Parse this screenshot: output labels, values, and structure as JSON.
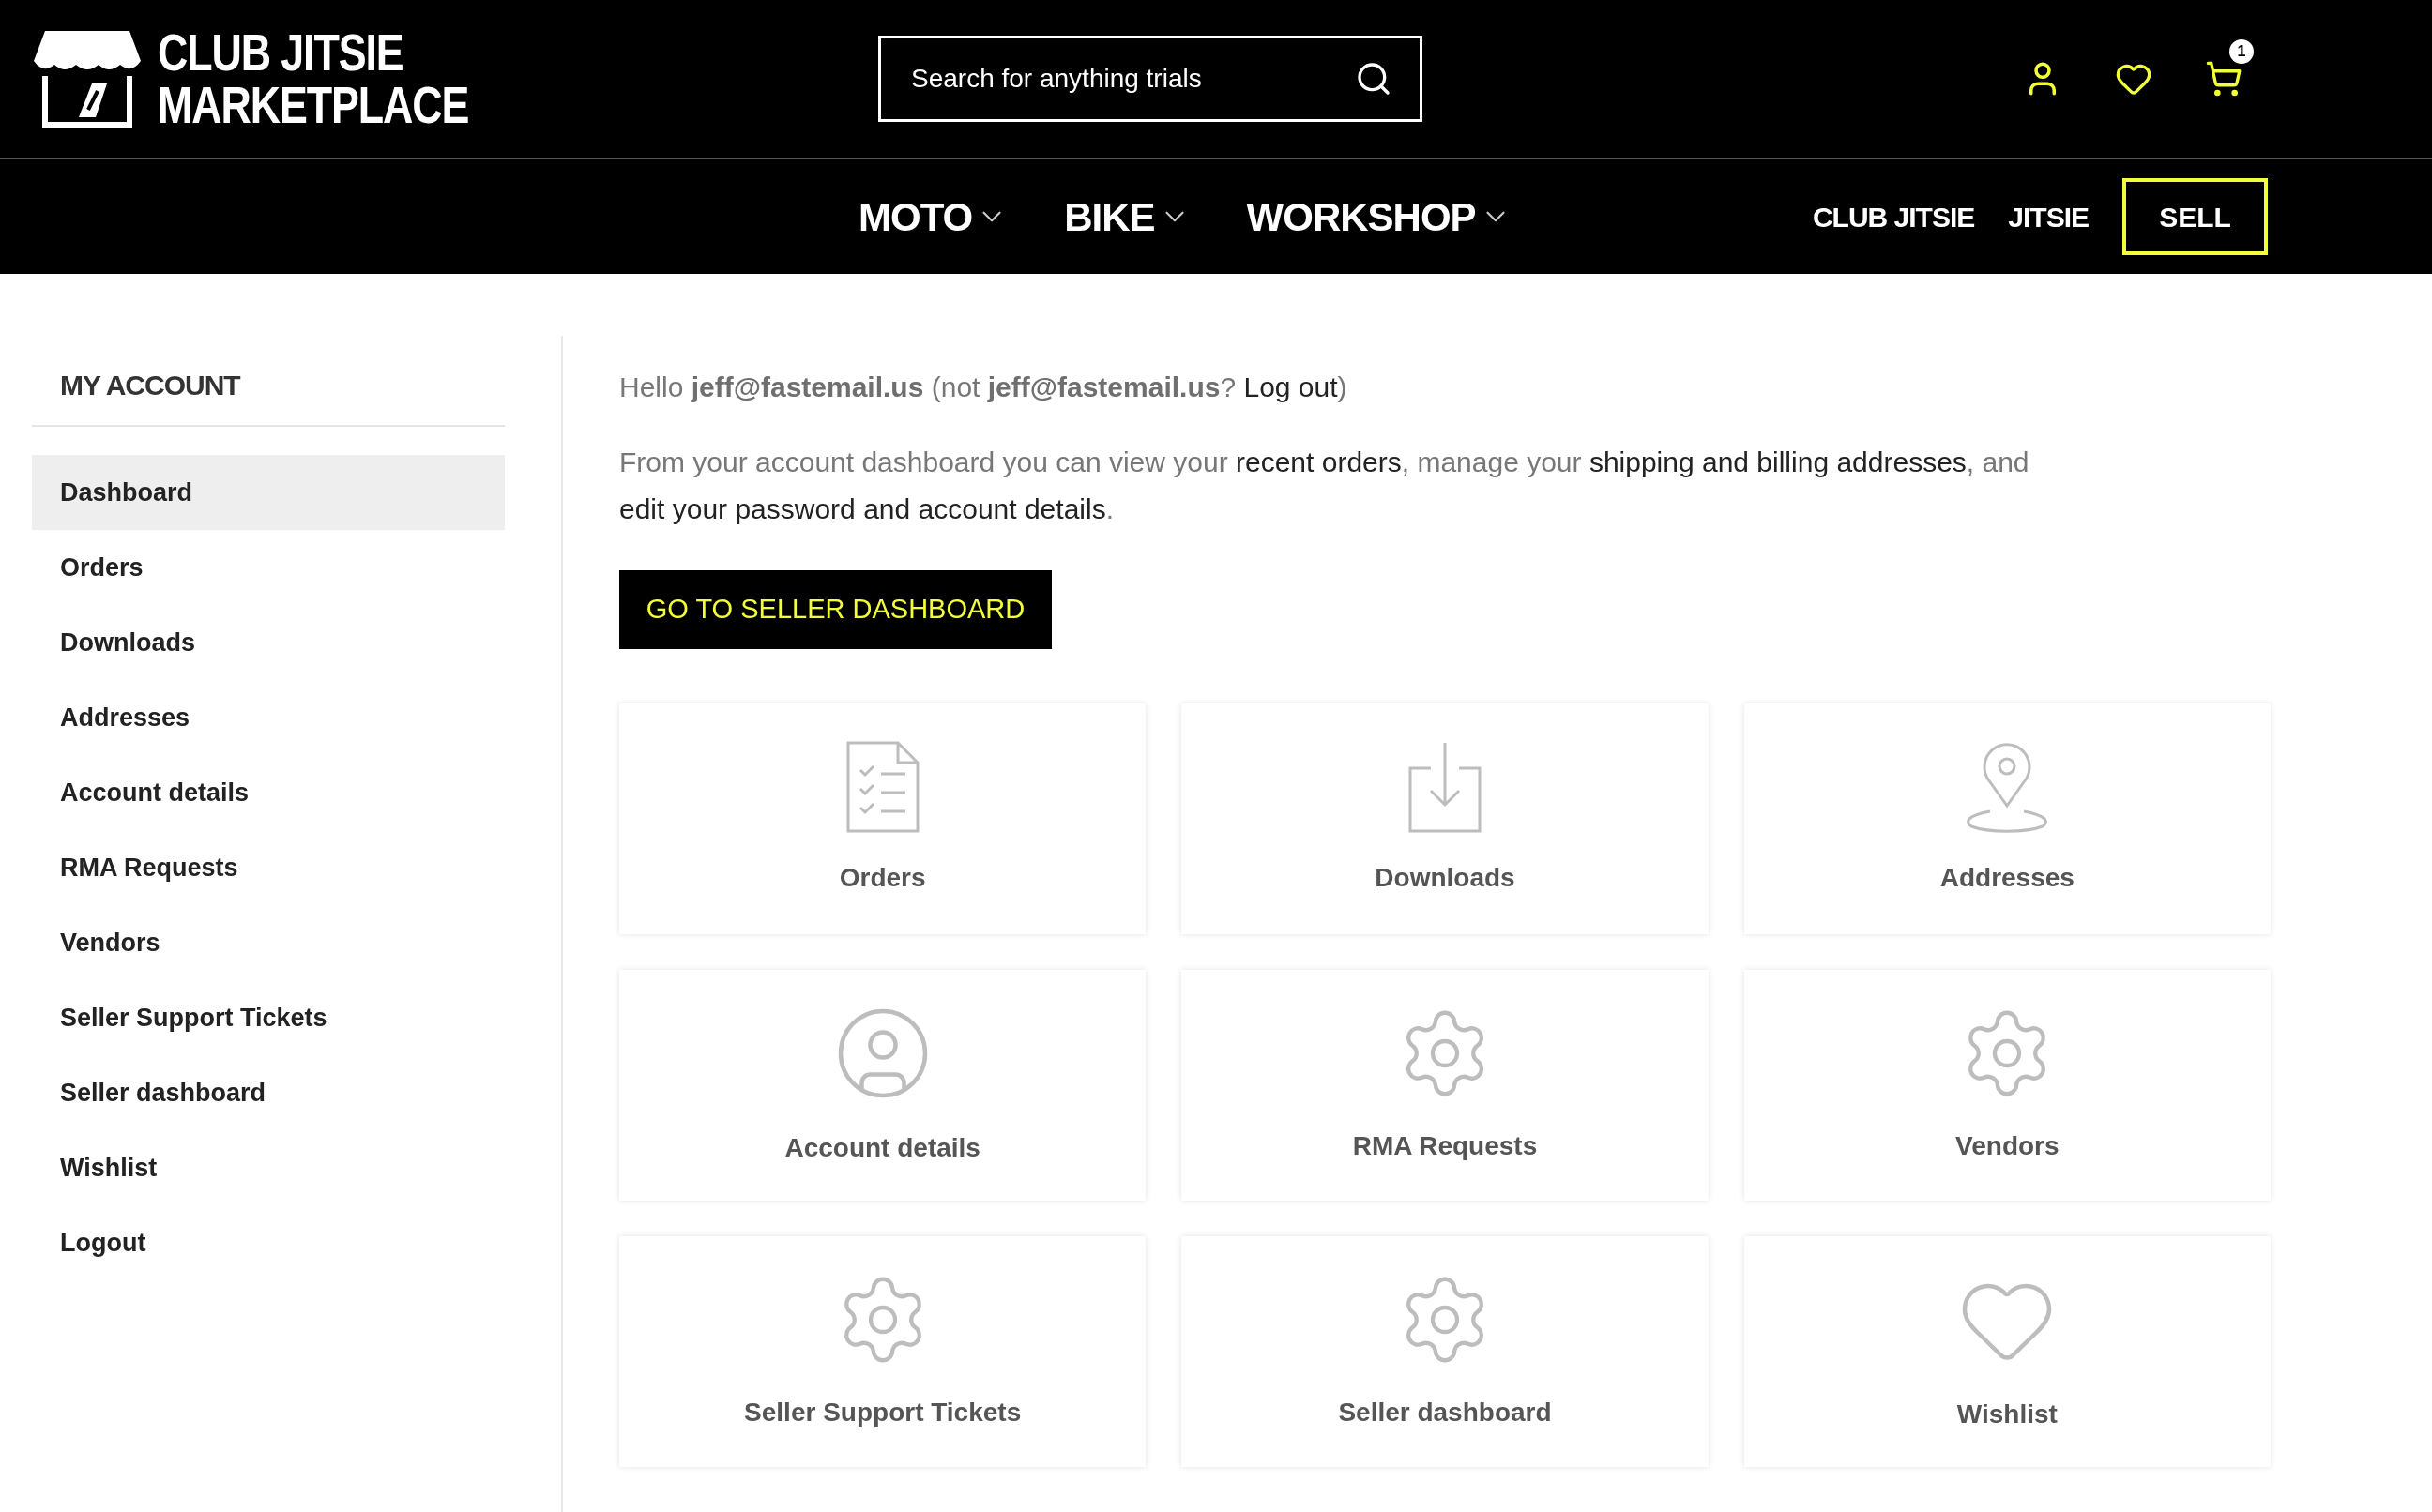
{
  "header": {
    "logo": {
      "line_1": "CLUB JITSIE",
      "line_2": "MARKETPLACE"
    },
    "search": {
      "placeholder": "Search for anything trials"
    },
    "cart_count": "1"
  },
  "nav": {
    "menus": [
      {
        "label": "MOTO"
      },
      {
        "label": "BIKE"
      },
      {
        "label": "WORKSHOP"
      }
    ],
    "links": [
      "CLUB JITSIE",
      "JITSIE"
    ],
    "sell_button": "SELL"
  },
  "sidebar": {
    "title": "MY ACCOUNT",
    "items": [
      {
        "label": "Dashboard",
        "selected": true
      },
      {
        "label": "Orders",
        "selected": false
      },
      {
        "label": "Downloads",
        "selected": false
      },
      {
        "label": "Addresses",
        "selected": false
      },
      {
        "label": "Account details",
        "selected": false
      },
      {
        "label": "RMA Requests",
        "selected": false
      },
      {
        "label": "Vendors",
        "selected": false
      },
      {
        "label": "Seller Support Tickets",
        "selected": false
      },
      {
        "label": "Seller dashboard",
        "selected": false
      },
      {
        "label": "Wishlist",
        "selected": false
      },
      {
        "label": "Logout",
        "selected": false
      }
    ]
  },
  "greeting": [
    {
      "kind": "plain",
      "text": "Hello "
    },
    {
      "kind": "strong",
      "text": "jeff@fastemail.us"
    },
    {
      "kind": "plain",
      "text": " (not "
    },
    {
      "kind": "strong",
      "text": "jeff@fastemail.us"
    },
    {
      "kind": "plain",
      "text": "? "
    },
    {
      "kind": "link",
      "text": "Log out"
    },
    {
      "kind": "plain",
      "text": ")"
    }
  ],
  "intro": [
    {
      "kind": "plain",
      "text": "From your account dashboard you can view your "
    },
    {
      "kind": "link",
      "text": "recent orders"
    },
    {
      "kind": "plain",
      "text": ", manage your "
    },
    {
      "kind": "link",
      "text": "shipping and billing addresses"
    },
    {
      "kind": "plain",
      "text": ", and "
    },
    {
      "kind": "link",
      "text": "edit your password and account details"
    },
    {
      "kind": "plain",
      "text": "."
    }
  ],
  "seller_button": "GO TO SELLER DASHBOARD",
  "cards": [
    {
      "label": "Orders"
    },
    {
      "label": "Downloads"
    },
    {
      "label": "Addresses"
    },
    {
      "label": "Account details"
    },
    {
      "label": "RMA Requests"
    },
    {
      "label": "Vendors"
    },
    {
      "label": "Seller Support Tickets"
    },
    {
      "label": "Seller dashboard"
    },
    {
      "label": "Wishlist"
    }
  ]
}
